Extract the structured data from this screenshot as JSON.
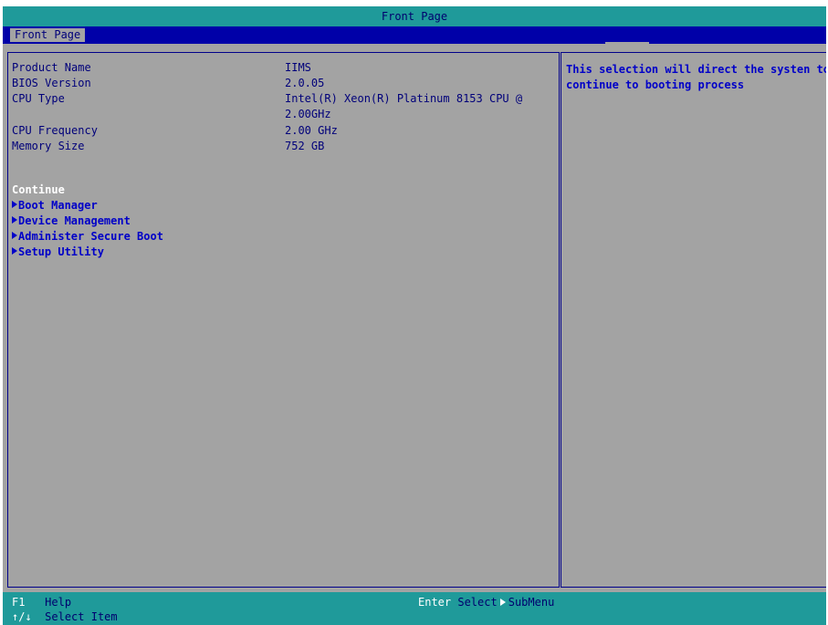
{
  "window": {
    "title": "Front Page"
  },
  "tabs": [
    {
      "label": "Front Page",
      "active": true
    }
  ],
  "info": {
    "rows": [
      {
        "label": "Product Name",
        "value": "IIMS"
      },
      {
        "label": "BIOS Version",
        "value": "2.0.05"
      },
      {
        "label": "CPU Type",
        "value": "Intel(R) Xeon(R) Platinum 8153 CPU @",
        "value_cont": "2.00GHz"
      },
      {
        "label": "CPU Frequency",
        "value": "2.00 GHz"
      },
      {
        "label": "Memory Size",
        "value": "752 GB"
      }
    ]
  },
  "menu": {
    "items": [
      {
        "label": "Continue",
        "selected": true,
        "submenu": false
      },
      {
        "label": "Boot Manager",
        "selected": false,
        "submenu": true
      },
      {
        "label": "Device Management",
        "selected": false,
        "submenu": true
      },
      {
        "label": "Administer Secure Boot",
        "selected": false,
        "submenu": true
      },
      {
        "label": "Setup Utility",
        "selected": false,
        "submenu": true
      }
    ]
  },
  "help": {
    "line1": "This selection will direct the systen to",
    "line2": "continue to booting process"
  },
  "footer": {
    "hint_f1_key": "F1",
    "hint_f1_text": "Help",
    "hint_nav_key": "↑/↓",
    "hint_nav_text": "Select Item",
    "hint_enter_key": "Enter",
    "hint_enter_text": "Select",
    "hint_enter_text2": "SubMenu"
  },
  "colors": {
    "title_bar": "#1f9a9a",
    "tab_strip": "#0000a8",
    "panel_bg": "#a3a3a3",
    "text": "#00007a",
    "highlight": "#0000c8",
    "selected": "#ffffff"
  }
}
